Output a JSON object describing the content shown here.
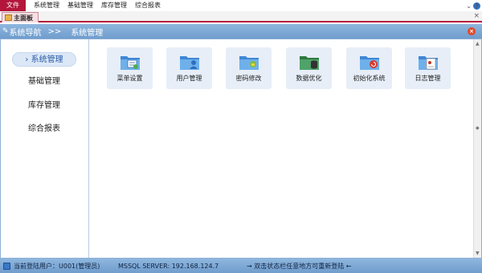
{
  "menubar": {
    "items": [
      "文件",
      "系统管理",
      "基础管理",
      "库存管理",
      "综合报表"
    ],
    "right_icons": [
      "chevron-down-icon",
      "help-icon"
    ],
    "accent_color": "#b4163b"
  },
  "tabstrip": {
    "tab_label": "主面板",
    "close_glyph": "×"
  },
  "navbar": {
    "title": "系统导航",
    "separator": ">>",
    "current": "系统管理"
  },
  "sidebar": {
    "items": [
      {
        "label": "系统管理",
        "active": true
      },
      {
        "label": "基础管理",
        "active": false
      },
      {
        "label": "库存管理",
        "active": false
      },
      {
        "label": "综合报表",
        "active": false
      }
    ]
  },
  "tiles": [
    {
      "label": "菜单设置",
      "icon": "folder-menu-icon"
    },
    {
      "label": "用户管理",
      "icon": "folder-user-icon"
    },
    {
      "label": "密码修改",
      "icon": "folder-password-icon"
    },
    {
      "label": "数据优化",
      "icon": "folder-database-icon"
    },
    {
      "label": "初始化系统",
      "icon": "folder-refresh-icon"
    },
    {
      "label": "日志管理",
      "icon": "folder-log-icon"
    }
  ],
  "statusbar": {
    "user": "当前登陆用户：U001(管理员)",
    "server": "MSSQL SERVER:  192.168.124.7",
    "hint": "→ 双击状态栏任意地方可重新登陆 ←"
  }
}
